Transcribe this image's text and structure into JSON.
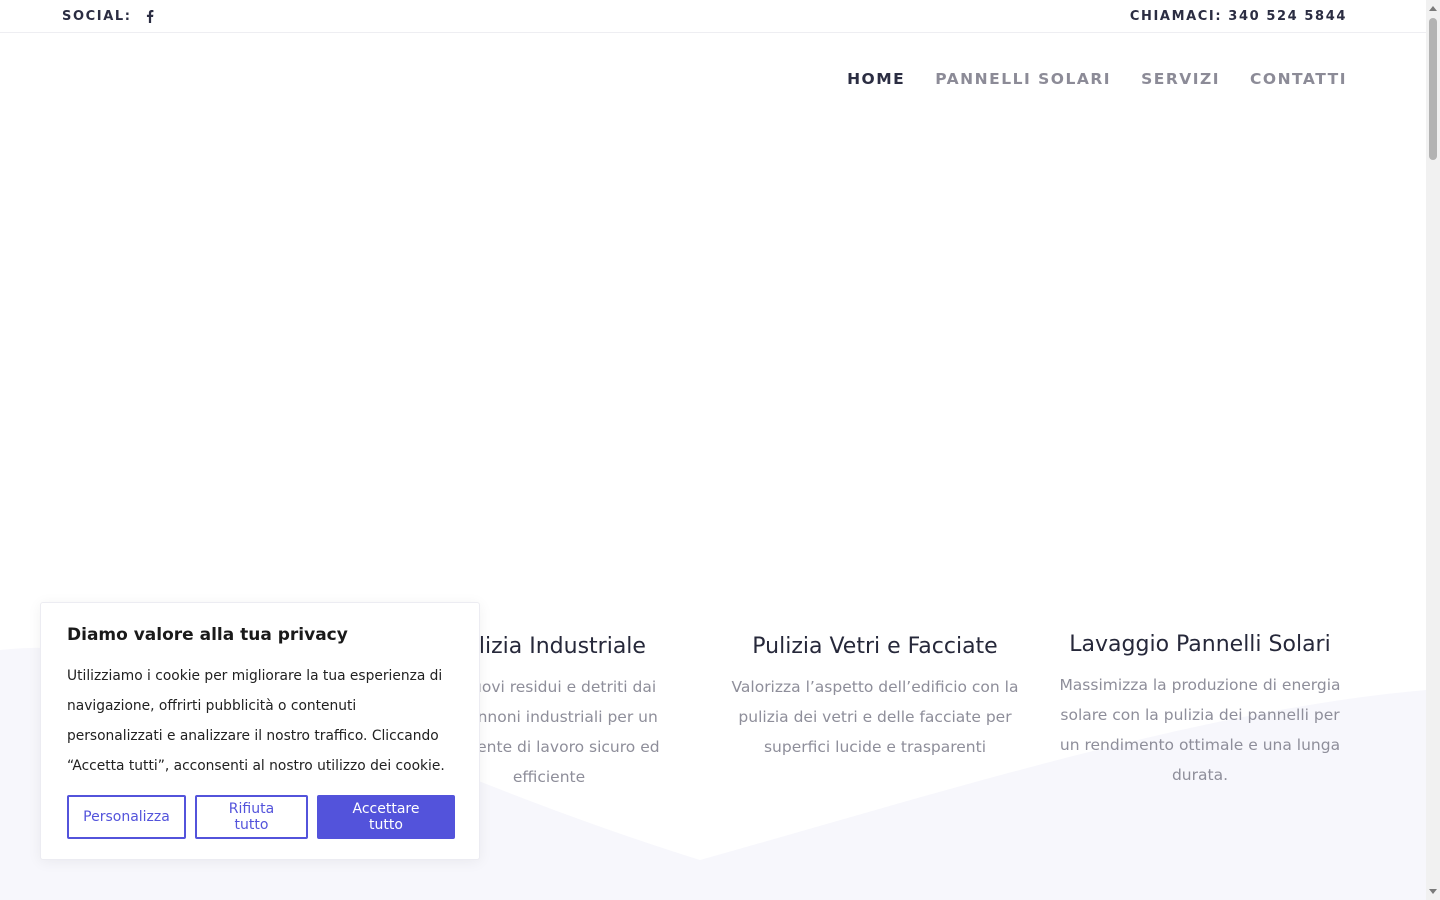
{
  "topbar": {
    "social_label": "SOCIAL:",
    "social_icon": "facebook-icon",
    "phone_label": "CHIAMACI: 340 524 5844"
  },
  "nav": {
    "items": [
      {
        "label": "HOME",
        "active": true
      },
      {
        "label": "PANNELLI SOLARI",
        "active": false
      },
      {
        "label": "SERVIZI",
        "active": false
      },
      {
        "label": "CONTATTI",
        "active": false
      }
    ]
  },
  "services": [
    {
      "title": "Pulizia Industriale",
      "text": "Rimuovi residui e detriti dai capannoni industriali per un ambiente di lavoro sicuro ed efficiente"
    },
    {
      "title": "Pulizia Vetri e Facciate",
      "text": "Valorizza l’aspetto dell’edificio con la pulizia dei vetri e delle facciate per superfici lucide e trasparenti"
    },
    {
      "title": "Lavaggio Pannelli Solari",
      "text": "Massimizza la produzione di energia solare con la pulizia dei pannelli per un rendimento ottimale e una lunga durata."
    }
  ],
  "cookie": {
    "title": "Diamo valore alla tua privacy",
    "text": "Utilizziamo i cookie per migliorare la tua esperienza di navigazione, offrirti pubblicità o contenuti personalizzati e analizzare il nostro traffico. Cliccando “Accetta tutti”, acconsenti al nostro utilizzo dei cookie.",
    "customize_label": "Personalizza",
    "reject_label": "Rifiuta tutto",
    "accept_label": "Accettare tutto"
  },
  "colors": {
    "accent": "#5353db",
    "heading": "#2b2d42",
    "muted": "#8e8e9a"
  }
}
